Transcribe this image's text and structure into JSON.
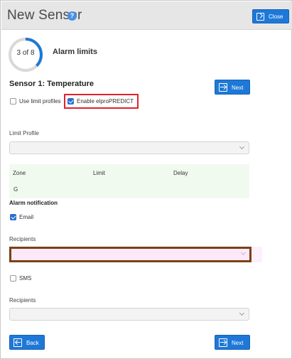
{
  "header": {
    "title": "New Sensor",
    "help_icon": "?",
    "close_label": "Close"
  },
  "wizard": {
    "progress_label": "3 of 8",
    "progress": 0.375,
    "step_title": "Alarm limits",
    "section_title": "Sensor 1: Temperature",
    "next_label": "Next",
    "back_label": "Back"
  },
  "options": {
    "use_limit_profiles": {
      "label": "Use limit profiles",
      "checked": false
    },
    "enable_elpro_predict": {
      "label": "Enable elproPREDICT",
      "checked": true
    }
  },
  "limit_profile": {
    "label": "Limit Profile",
    "value": ""
  },
  "limits_table": {
    "columns": [
      "Zone",
      "Limit",
      "Delay"
    ],
    "rows": [
      [
        "G",
        "",
        ""
      ]
    ]
  },
  "alarm_notification": {
    "title": "Alarm notification",
    "email": {
      "label": "Email",
      "checked": true
    },
    "email_recipients_label": "Recipients",
    "sms": {
      "label": "SMS",
      "checked": false
    },
    "sms_recipients_label": "Recipients"
  },
  "colors": {
    "accent": "#1e78d7",
    "highlight_red": "#e5202a",
    "highlight_brown": "#7a4116",
    "table_bg": "#f1faef"
  }
}
